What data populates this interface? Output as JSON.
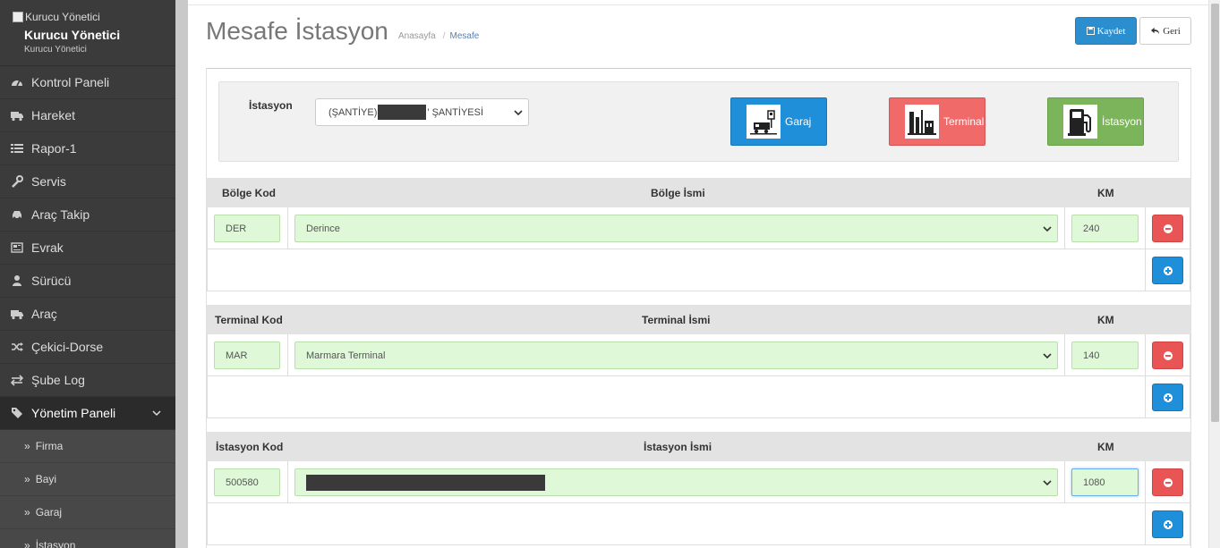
{
  "sidebar": {
    "logo_alt": "Kurucu Yönetici",
    "user_name": "Kurucu Yönetici",
    "user_role": "Kurucu Yönetici",
    "items": [
      {
        "label": "Kontrol Paneli",
        "icon": "dashboard-icon"
      },
      {
        "label": "Hareket",
        "icon": "truck-icon"
      },
      {
        "label": "Rapor-1",
        "icon": "list-icon"
      },
      {
        "label": "Servis",
        "icon": "wrench-icon"
      },
      {
        "label": "Araç Takip",
        "icon": "car-icon"
      },
      {
        "label": "Evrak",
        "icon": "newspaper-icon"
      },
      {
        "label": "Sürücü",
        "icon": "user-icon"
      },
      {
        "label": "Araç",
        "icon": "truck-icon"
      },
      {
        "label": "Çekici-Dorse",
        "icon": "random-icon"
      },
      {
        "label": "Şube Log",
        "icon": "exchange-icon"
      },
      {
        "label": "Yönetim Paneli",
        "icon": "tags-icon"
      }
    ],
    "sub_items": [
      "Firma",
      "Bayi",
      "Garaj",
      "İstasyon"
    ]
  },
  "header": {
    "title": "Mesafe İstasyon",
    "breadcrumb_home": "Anasayfa",
    "breadcrumb_sep": "/",
    "breadcrumb_current": "Mesafe",
    "save_label": "Kaydet",
    "back_label": "Geri"
  },
  "station": {
    "label": "İstasyon",
    "select_prefix": "(ŞANTİYE)",
    "select_suffix": "' ŞANTİYESİ"
  },
  "tiles": {
    "garaj": "Garaj",
    "terminal": "Terminal",
    "istasyon": "İstasyon"
  },
  "sections": [
    {
      "code_header": "Bölge Kod",
      "name_header": "Bölge İsmi",
      "km_header": "KM",
      "code": "DER",
      "name": "Derince",
      "km": "240"
    },
    {
      "code_header": "Terminal Kod",
      "name_header": "Terminal İsmi",
      "km_header": "KM",
      "code": "MAR",
      "name": "Marmara Terminal",
      "km": "140"
    },
    {
      "code_header": "İstasyon Kod",
      "name_header": "İstasyon İsmi",
      "km_header": "KM",
      "code": "500580",
      "name": "",
      "km": "1080"
    }
  ],
  "colors": {
    "sidebar_bg": "#3b3b3b",
    "primary": "#1e8fd8",
    "danger": "#e95555",
    "success": "#7bb45a",
    "terminal": "#f06a6a",
    "field_bg": "#dff8d8"
  }
}
